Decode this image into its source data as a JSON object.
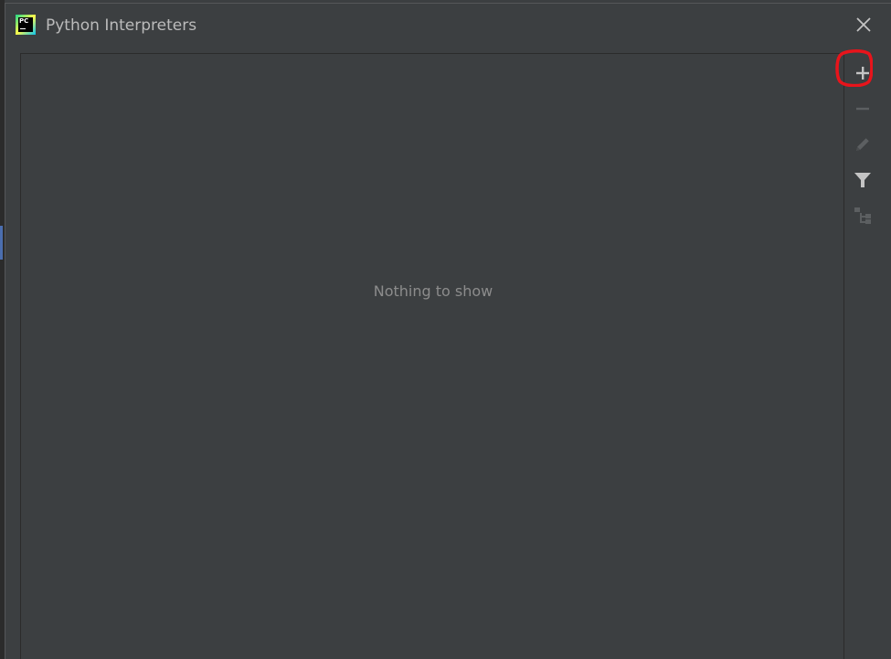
{
  "dialog": {
    "title": "Python Interpreters",
    "app_icon": {
      "name": "pycharm-icon",
      "text": "PC"
    },
    "close_icon": "close-icon"
  },
  "list": {
    "empty_text": "Nothing to show"
  },
  "toolbar": {
    "items": [
      {
        "name": "add-interpreter-button",
        "icon": "plus-icon",
        "enabled": true
      },
      {
        "name": "remove-interpreter-button",
        "icon": "minus-icon",
        "enabled": false
      },
      {
        "name": "edit-interpreter-button",
        "icon": "pencil-icon",
        "enabled": false
      },
      {
        "name": "filter-button",
        "icon": "filter-icon",
        "enabled": true
      },
      {
        "name": "show-paths-button",
        "icon": "tree-icon",
        "enabled": false
      }
    ]
  },
  "annotation": {
    "highlighted": "add-interpreter-button",
    "color": "#e8141b"
  },
  "colors": {
    "background": "#3c3f41",
    "text": "#bbbbbb",
    "muted_text": "#8c8c8c",
    "icon_enabled": "#c4c4c4",
    "icon_disabled": "#5c5f61",
    "selection": "#4b6eaf"
  }
}
